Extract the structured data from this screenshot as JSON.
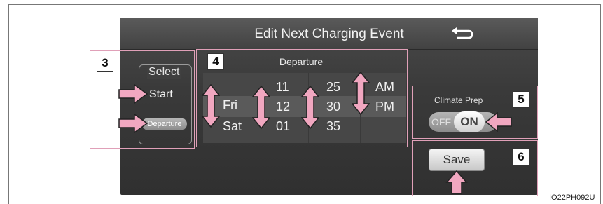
{
  "header": {
    "title": "Edit Next Charging Event",
    "back_icon": "back-arrow-icon"
  },
  "select_group": {
    "label": "Select",
    "start": "Start",
    "departure": "Departure"
  },
  "picker": {
    "title": "Departure",
    "day_col": [
      "Fri",
      "Sat"
    ],
    "hour_col": [
      "11",
      "12",
      "01"
    ],
    "min_col": [
      "25",
      "30",
      "35"
    ],
    "ampm_col": [
      "AM",
      "PM"
    ]
  },
  "climate": {
    "label": "Climate Prep",
    "off": "OFF",
    "on": "ON"
  },
  "save": {
    "label": "Save"
  },
  "callouts": [
    "3",
    "4",
    "5",
    "6"
  ],
  "figure_code": "IO22PH092U",
  "colors": {
    "arrow": "#f1a7c0",
    "callout_border": "#e0a0b8",
    "screen_bg": "#3e3e3e"
  }
}
